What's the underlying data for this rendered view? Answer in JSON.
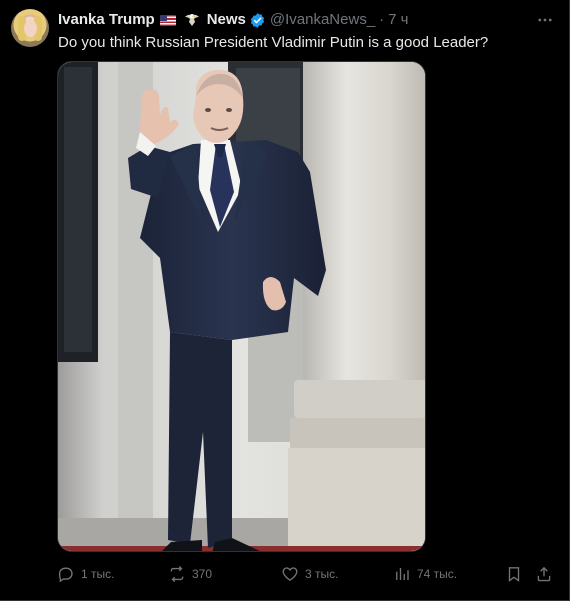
{
  "colors": {
    "background": "#000000",
    "text_primary": "#e7e9ea",
    "text_secondary": "#71767b",
    "verified": "#1d9bf0",
    "border": "#2f3336"
  },
  "tweet": {
    "author": {
      "name": "Ivanka Trump",
      "flag_icon": "us-flag-icon",
      "extra_icon": "eagle-icon",
      "label": "News",
      "verified_icon": "verified-badge-icon",
      "handle": "@IvankaNews_",
      "separator": "·",
      "time": "7 ч"
    },
    "more_icon": "more-horizontal-icon",
    "text": "Do you think Russian President Vladimir Putin is a good Leader?",
    "media_icon": "photo-icon",
    "actions": {
      "reply": {
        "icon": "reply-icon",
        "count": "1 тыс."
      },
      "retweet": {
        "icon": "retweet-icon",
        "count": "370"
      },
      "like": {
        "icon": "heart-icon",
        "count": "3 тыс."
      },
      "views": {
        "icon": "views-icon",
        "count": "74 тыс."
      },
      "bookmark": {
        "icon": "bookmark-icon"
      },
      "share": {
        "icon": "share-icon"
      }
    }
  }
}
